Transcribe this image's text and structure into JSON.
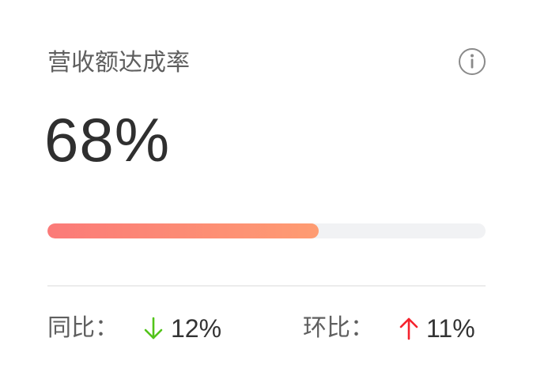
{
  "card": {
    "title": "营收额达成率",
    "value": "68%",
    "progress": {
      "fraction": 0.62
    },
    "yoy": {
      "label": "同比：",
      "direction": "down",
      "value": "12%"
    },
    "mom": {
      "label": "环比：",
      "direction": "up",
      "value": "11%"
    }
  },
  "colors": {
    "title_text": "#5f5f5f",
    "value_text": "#2f2f2f",
    "progress_start": "#fb7a78",
    "progress_end": "#fe9c72",
    "track": "#f1f2f4",
    "down_arrow": "#52c41a",
    "up_arrow": "#f5222d"
  },
  "icons": {
    "info": "info-circle-icon",
    "down": "arrow-down-icon",
    "up": "arrow-up-icon"
  }
}
